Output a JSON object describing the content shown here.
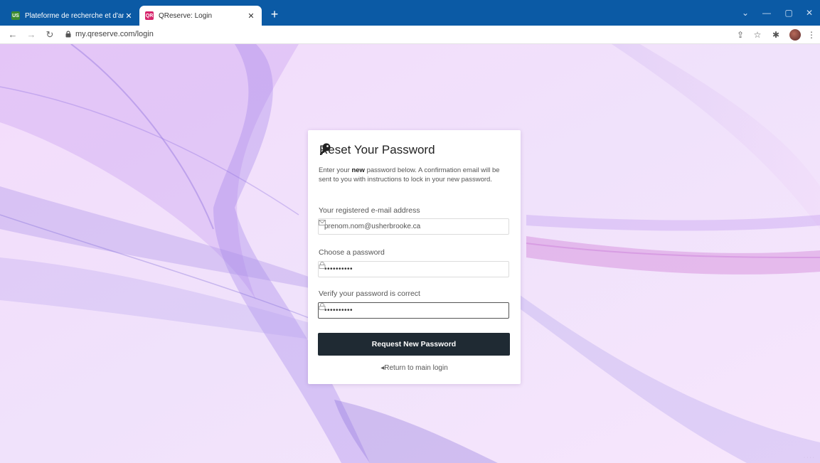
{
  "browser": {
    "tabs": [
      {
        "title": "Plateforme de recherche et d'an",
        "favicon": "US",
        "active": false
      },
      {
        "title": "QReserve: Login",
        "favicon": "QR",
        "active": true
      }
    ],
    "url": "my.qreserve.com/login",
    "accent_color": "#0b5aa5"
  },
  "card": {
    "title": "Reset Your Password",
    "intro_before": "Enter your ",
    "intro_bold": "new",
    "intro_after": " password below. A confirmation email will be sent to you with instructions to lock in your new password.",
    "email_label": "Your registered e-mail address",
    "email_value": "prenom.nom@usherbrooke.ca",
    "password_label": "Choose a password",
    "password_value": "••••••••••",
    "verify_label": "Verify your password is correct",
    "verify_value": "••••••••••",
    "submit_label": "Request New Password",
    "return_label": "Return to main login",
    "button_color": "#1f2a33"
  }
}
